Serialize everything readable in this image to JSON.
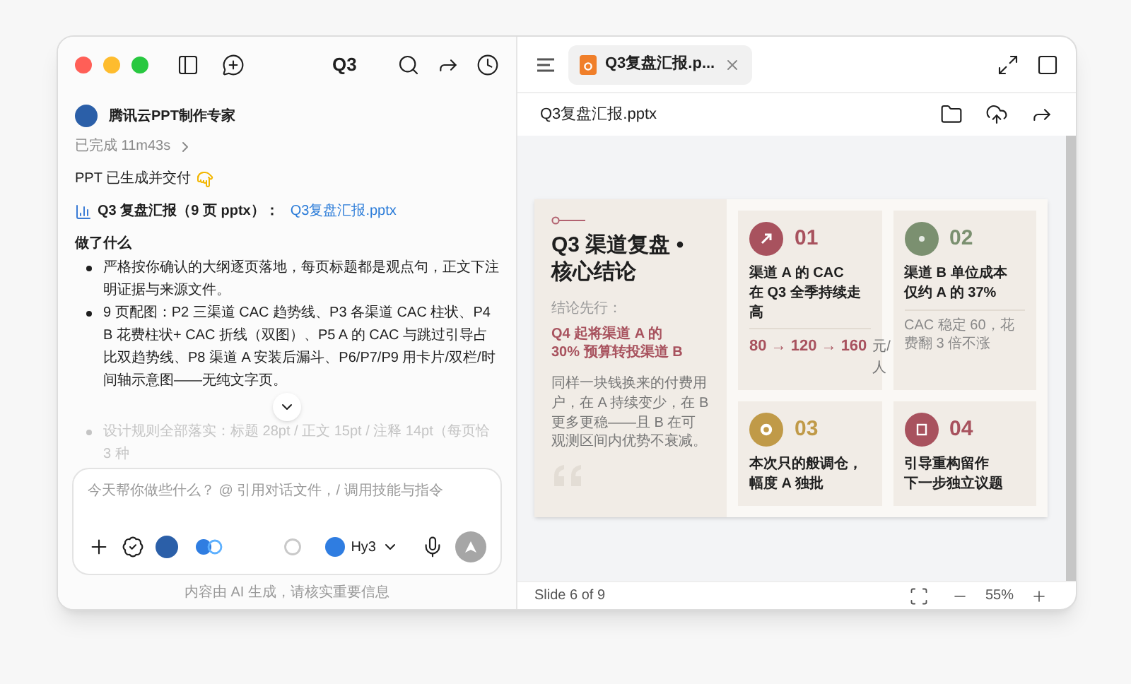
{
  "chat": {
    "title": "Q3",
    "agent": {
      "name": "腾讯云PPT制作专家",
      "status": "已完成 11m43s"
    },
    "delivered": "PPT 已生成并交付",
    "file_line": {
      "label": "Q3 复盘汇报（9 页 pptx）：",
      "link": "Q3复盘汇报.pptx"
    },
    "section_heading": "做了什么",
    "bullets": [
      {
        "text": "严格按你确认的大纲逐页落地，每页标题都是观点句，正文下注明证据与来源文件。",
        "faded": false
      },
      {
        "text": "9 页配图：P2 三渠道 CAC 趋势线、P3 各渠道 CAC 柱状、P4 B 花费柱状+ CAC 折线（双图）、P5 A 的 CAC 与跳过引导占比双趋势线、P8 渠道 A 安装后漏斗、P6/P7/P9 用卡片/双栏/时间轴示意图——无纯文字页。",
        "faded": false
      },
      {
        "text": "设计规则全部落实：标题 28pt / 正文 15pt / 注释 14pt（每页恰 3 种",
        "faded": true
      }
    ],
    "composer": {
      "placeholder": "今天帮你做些什么？ @ 引用对话文件，/ 调用技能与指令",
      "model": "Hy3"
    },
    "footer": "内容由 AI 生成，请核实重要信息"
  },
  "preview": {
    "tabs": [
      {
        "label": "Q3复盘汇报.p...",
        "selected": true
      }
    ],
    "file_title": "Q3复盘汇报.pptx",
    "slide": {
      "title_lines": [
        "Q3 渠道复盘 •",
        "核心结论"
      ],
      "lead": "结论先行：",
      "headline_lines": [
        "Q4 起将渠道 A 的",
        "30% 预算转投渠道 B"
      ],
      "body": "同样一块钱换来的付费用户，在 A 持续变少，在 B 更多更稳——且 B 在可观测区间内优势不衰减。",
      "cards": [
        {
          "number": "01",
          "color": "#a8525e",
          "kind": "arrow",
          "title_lines": [
            "渠道 A 的 CAC",
            "在 Q3 全季持续走高"
          ],
          "metric": "80 → 120 → 160",
          "unit": "元/人"
        },
        {
          "number": "02",
          "color": "#7b9070",
          "kind": "dot",
          "title_lines": [
            "渠道 B 单位成本",
            "仅约 A 的 37%"
          ],
          "note": "CAC 稳定 60，花费翻 3 倍不涨"
        },
        {
          "number": "03",
          "color": "#c09a48",
          "kind": "ring",
          "title_lines": [
            "本次只的般调仓，",
            "幅度 A 独批"
          ]
        },
        {
          "number": "04",
          "color": "#a8525e",
          "kind": "list",
          "title_lines": [
            "引导重构留作",
            "下一步独立议题"
          ]
        }
      ]
    },
    "status": {
      "slide": "Slide 6 of 9",
      "zoom": "55%"
    }
  }
}
